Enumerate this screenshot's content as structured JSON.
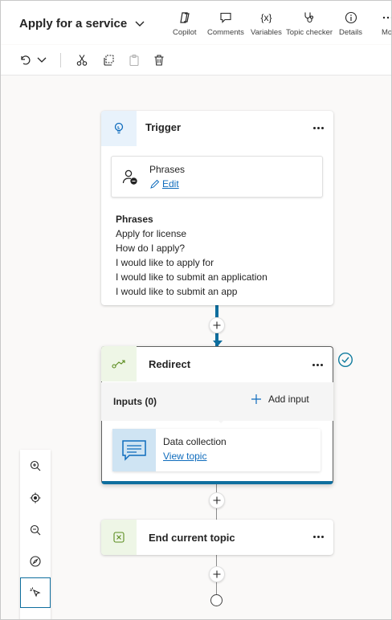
{
  "header": {
    "title": "Apply for a service",
    "buttons": [
      {
        "label": "Copilot",
        "icon": "copilot-icon"
      },
      {
        "label": "Comments",
        "icon": "comment-icon"
      },
      {
        "label": "Variables",
        "icon": "variables-icon"
      },
      {
        "label": "Topic checker",
        "icon": "stethoscope-icon"
      },
      {
        "label": "Details",
        "icon": "info-icon"
      },
      {
        "label": "Mo",
        "icon": "more-icon"
      }
    ],
    "variables_glyph": "{x}"
  },
  "toolbar": {
    "undo": "undo-icon",
    "undo_menu": "chevron-down-icon",
    "cut": "cut-icon",
    "copy": "copy-icon",
    "paste": "paste-icon",
    "delete": "delete-icon"
  },
  "trigger": {
    "title": "Trigger",
    "card_title": "Phrases",
    "edit_label": "Edit",
    "list_heading": "Phrases",
    "phrases": [
      "Apply for license",
      "How do I apply?",
      "I would like to apply for",
      "I would like to submit an application",
      "I would like to submit an app"
    ]
  },
  "redirect": {
    "title": "Redirect",
    "inputs_label": "Inputs (0)",
    "add_input_label": "Add input",
    "topic_name": "Data collection",
    "view_topic_label": "View topic"
  },
  "end": {
    "title": "End current topic"
  },
  "colors": {
    "accent": "#0f6cbd",
    "connector_active": "#0e6e9e",
    "trigger_icon_bg": "#e8f2fb",
    "redirect_icon_bg": "#eef6e6",
    "topic_icon_bg": "#cfe4f3",
    "check": "#0f7b9e"
  }
}
